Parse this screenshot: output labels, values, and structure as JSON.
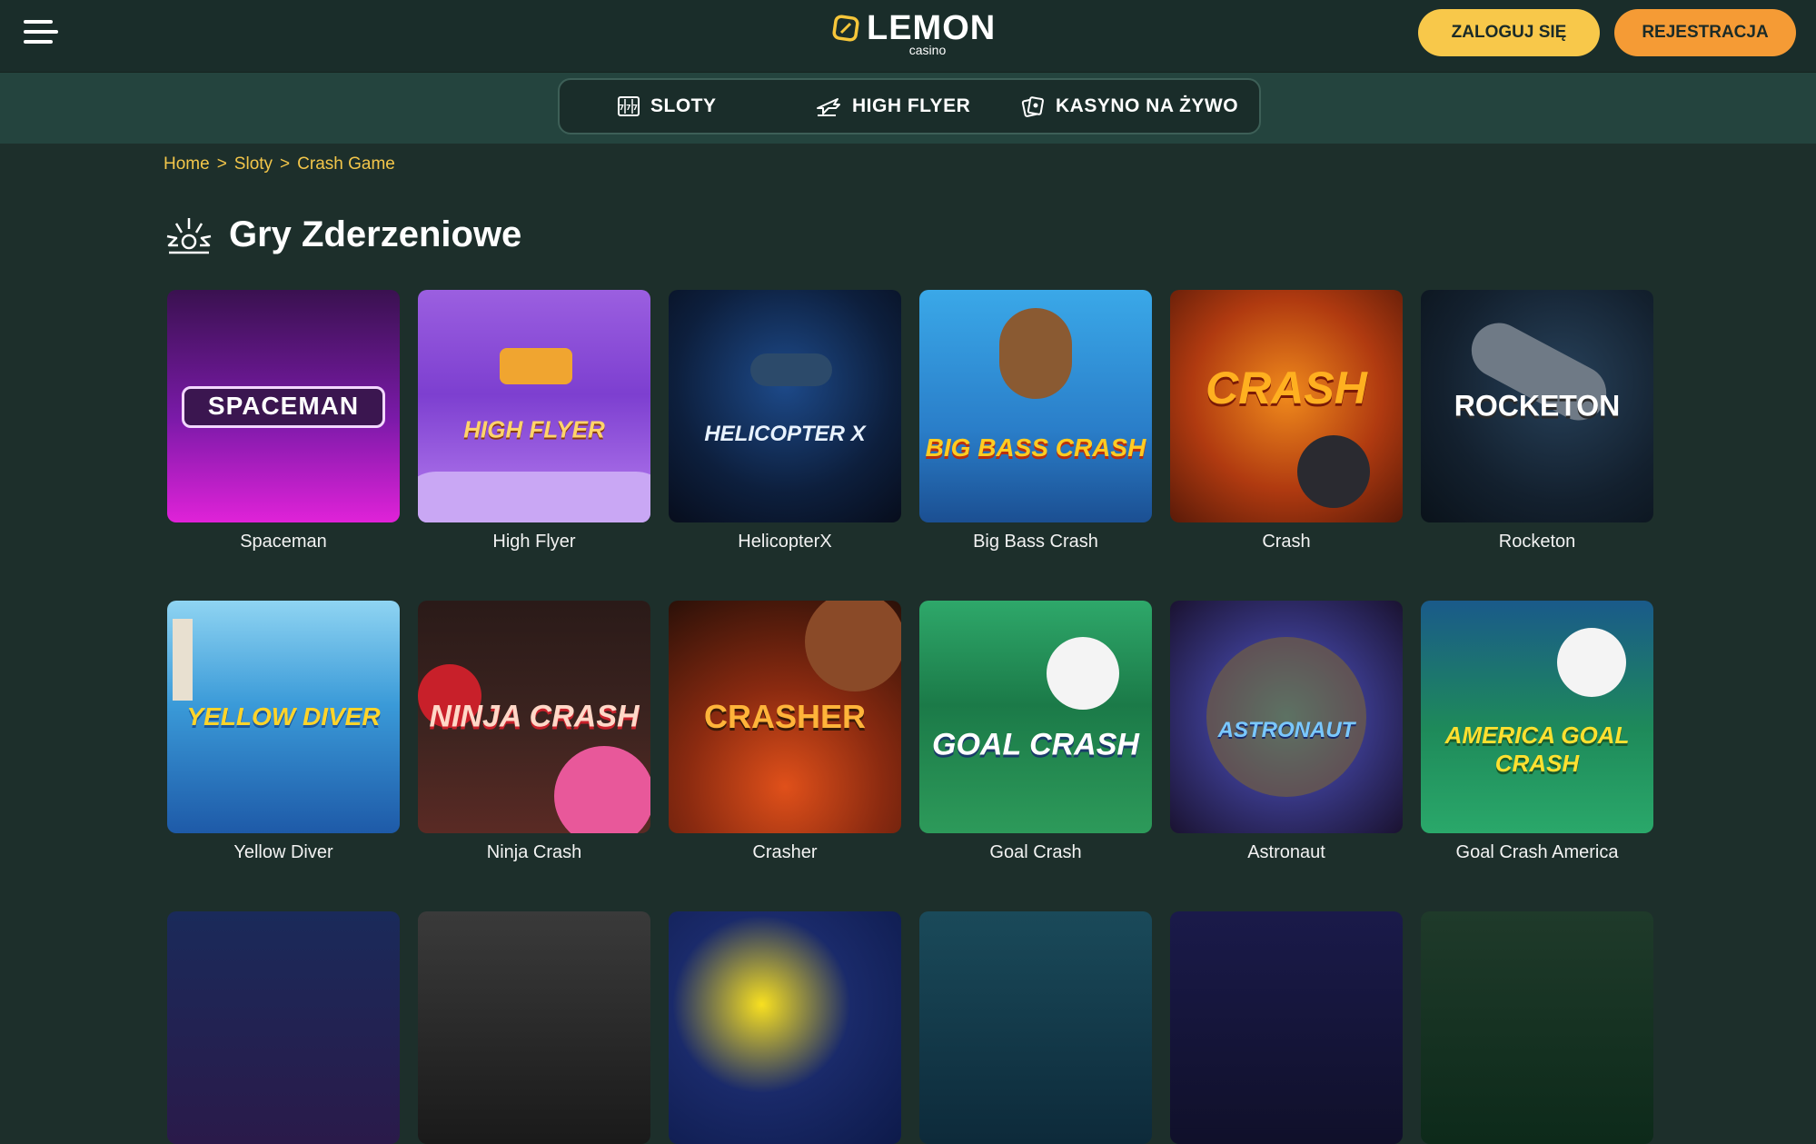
{
  "header": {
    "logo_main": "LEMON",
    "logo_sub": "casino",
    "login_label": "ZALOGUJ SIĘ",
    "register_label": "REJESTRACJA",
    "colors": {
      "login_bg": "#f8c84a",
      "register_bg": "#f59b35",
      "header_bg": "#1a2d2a"
    }
  },
  "subnav": {
    "items": [
      {
        "label": "SLOTY",
        "icon": "slots-icon"
      },
      {
        "label": "HIGH FLYER",
        "icon": "airplane-icon"
      },
      {
        "label": "KASYNO NA ŻYWO",
        "icon": "cards-icon"
      }
    ]
  },
  "breadcrumb": {
    "items": [
      "Home",
      "Sloty",
      "Crash Game"
    ],
    "separator": ">"
  },
  "page": {
    "title": "Gry Zderzeniowe",
    "icon": "explosion-icon"
  },
  "games": [
    {
      "name": "Spaceman",
      "art": "SPACEMAN"
    },
    {
      "name": "High Flyer",
      "art": "HIGH FLYER"
    },
    {
      "name": "HelicopterX",
      "art": "HELICOPTER X"
    },
    {
      "name": "Big Bass Crash",
      "art": "BIG BASS CRASH"
    },
    {
      "name": "Crash",
      "art": "CRASH"
    },
    {
      "name": "Rocketon",
      "art": "ROCKETON"
    },
    {
      "name": "Yellow Diver",
      "art": "YELLOW DIVER"
    },
    {
      "name": "Ninja Crash",
      "art": "NINJA CRASH"
    },
    {
      "name": "Crasher",
      "art": "CRASHER"
    },
    {
      "name": "Goal Crash",
      "art": "GOAL CRASH"
    },
    {
      "name": "Astronaut",
      "art": "ASTRONAUT"
    },
    {
      "name": "Goal Crash America",
      "art": "AMERICA GOAL CRASH"
    }
  ]
}
